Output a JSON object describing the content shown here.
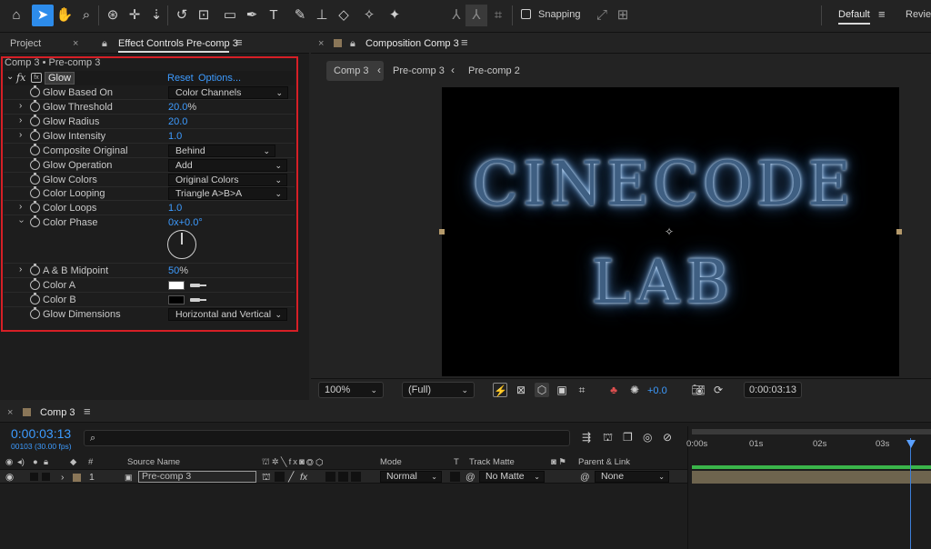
{
  "toolbar": {
    "tools": [
      "home-icon",
      "selection-icon",
      "hand-icon",
      "zoom-icon",
      "orbit-camera-icon",
      "track-xy-camera-icon",
      "dolly-camera-icon",
      "rotation-icon",
      "pan-behind-icon",
      "rectangle-icon",
      "pen-icon",
      "type-icon",
      "brush-icon",
      "clone-stamp-icon",
      "eraser-icon",
      "roto-brush-icon",
      "puppet-pin-icon"
    ],
    "snapping_label": "Snapping",
    "workspace_default": "Default",
    "workspace_review": "Review"
  },
  "left_panel": {
    "tab_project": "Project",
    "tab_effect_controls": "Effect Controls Pre-comp 3",
    "breadcrumb": "Comp 3 • Pre-comp 3",
    "effect": {
      "fx_label": "fx",
      "name": "Glow",
      "reset_label": "Reset",
      "options_label": "Options..."
    },
    "properties": [
      {
        "name": "Glow Based On",
        "dropdown": "Color Channels",
        "twirl": false
      },
      {
        "name": "Glow Threshold",
        "value": "20.0",
        "unit": "%",
        "twirl": true
      },
      {
        "name": "Glow Radius",
        "value": "20.0",
        "twirl": true
      },
      {
        "name": "Glow Intensity",
        "value": "1.0",
        "twirl": true
      },
      {
        "name": "Composite Original",
        "dropdown": "Behind",
        "twirl": false
      },
      {
        "name": "Glow Operation",
        "dropdown": "Add",
        "twirl": false
      },
      {
        "name": "Glow Colors",
        "dropdown": "Original Colors",
        "twirl": false
      },
      {
        "name": "Color Looping",
        "dropdown": "Triangle A>B>A",
        "twirl": false
      },
      {
        "name": "Color Loops",
        "value": "1.0",
        "twirl": true
      },
      {
        "name": "Color Phase",
        "value": "0x+0.0°",
        "twirl": true
      },
      {
        "name": "A & B Midpoint",
        "value": "50",
        "unit": "%",
        "twirl": true
      },
      {
        "name": "Color A",
        "color": "#ffffff",
        "twirl": false
      },
      {
        "name": "Color B",
        "color": "#000000",
        "twirl": false
      },
      {
        "name": "Glow Dimensions",
        "dropdown": "Horizontal and Vertical",
        "twirl": false
      }
    ]
  },
  "comp_panel": {
    "tab_title": "Composition Comp 3",
    "breadcrumbs": [
      "Comp 3",
      "Pre-comp 3",
      "Pre-comp 2"
    ],
    "text_line1": "CINECODE",
    "text_line2": "LAB",
    "zoom": "100%",
    "resolution": "(Full)",
    "exposure": "+0.0",
    "current_time": "0:00:03:13"
  },
  "timeline": {
    "tab_title": "Comp 3",
    "current_time": "0:00:03:13",
    "frame_info": "00103 (30.00 fps)",
    "search_placeholder": "",
    "headers": {
      "number": "#",
      "source_name": "Source Name",
      "mode": "Mode",
      "t": "T",
      "track_matte": "Track Matte",
      "parent_link": "Parent & Link"
    },
    "layer": {
      "number": "1",
      "name": "Pre-comp 3",
      "mode": "Normal",
      "track_matte": "No Matte",
      "parent": "None"
    },
    "ruler": [
      "0:00s",
      "01s",
      "02s",
      "03s"
    ]
  },
  "colors": {
    "accent_blue": "#3d9bff",
    "highlight_red": "#d61f26",
    "layer_bar": "#6e644e",
    "glow_blue": "#7fb2e8"
  }
}
